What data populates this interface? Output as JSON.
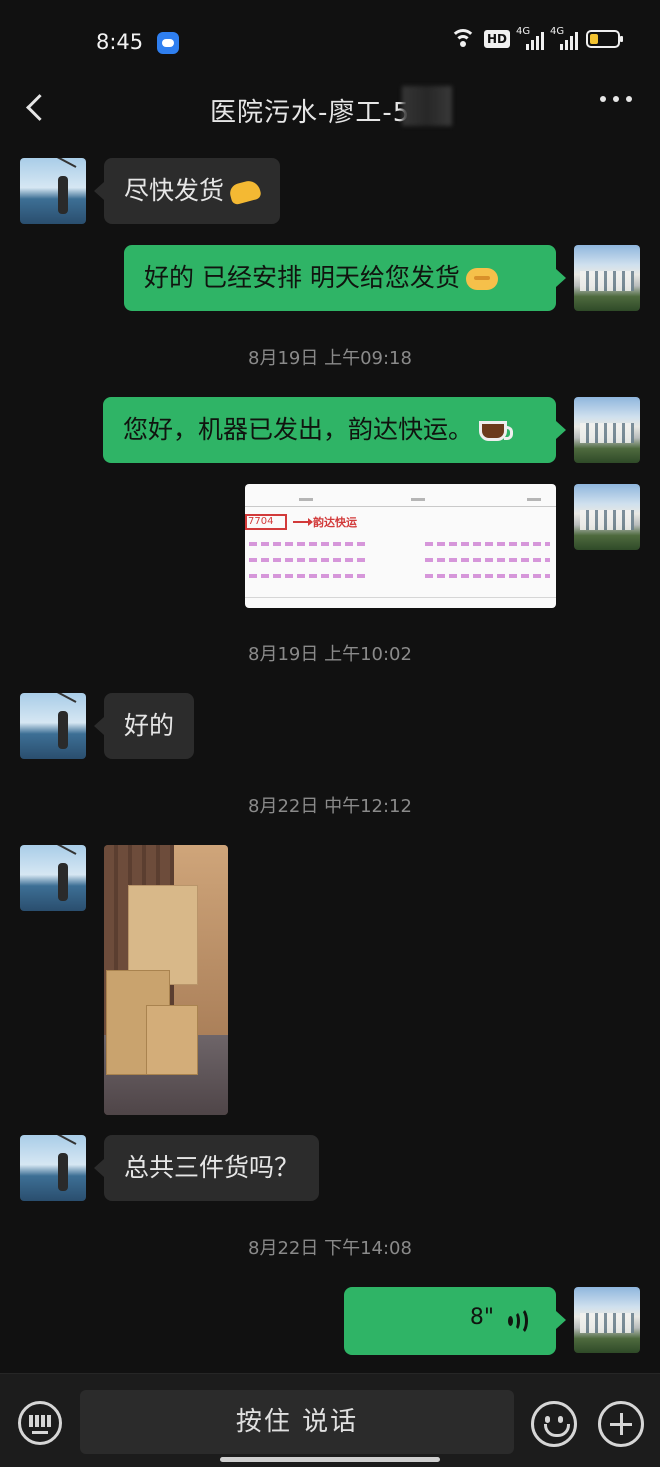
{
  "status_bar": {
    "time": "8:45",
    "hd_label": "HD",
    "signal1": "4G",
    "signal2": "4G"
  },
  "header": {
    "title": "医院污水-廖工-5"
  },
  "messages": {
    "m1": {
      "text": "尽快发货",
      "emoji": "folded-hands-emoji"
    },
    "m2": {
      "text": "好的 已经安排 明天给您发货",
      "emoji": "handshake-emoji"
    },
    "t1": "8月19日 上午09:18",
    "m3": {
      "text": "您好，机器已发出，韵达快运。",
      "emoji": "coffee-emoji"
    },
    "receipt": {
      "tracking_fragment": "7704",
      "courier": "韵达快运"
    },
    "t2": "8月19日 上午10:02",
    "m4": {
      "text": "好的"
    },
    "t3": "8月22日 中午12:12",
    "m5": {
      "text": "总共三件货吗？"
    },
    "t4": "8月22日 下午14:08",
    "voice": {
      "duration": "8\""
    }
  },
  "input_bar": {
    "talk_label": "按住 说话"
  },
  "colors": {
    "background": "#111111",
    "incoming_bubble": "#2c2c2c",
    "outgoing_bubble": "#2fb466",
    "timestamp_text": "#8a8a8a"
  }
}
